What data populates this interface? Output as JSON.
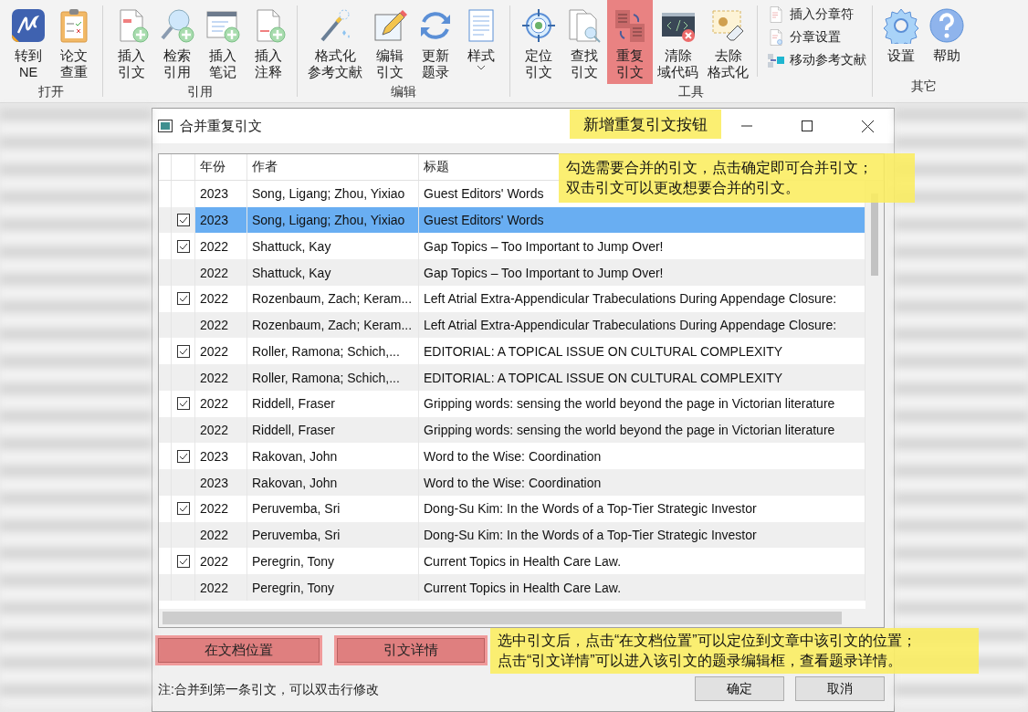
{
  "ribbon": {
    "groups": [
      {
        "label": "打开",
        "buttons": [
          {
            "lines": [
              "转到",
              "NE"
            ],
            "highlighted": false
          },
          {
            "lines": [
              "论文",
              "查重"
            ],
            "highlighted": false
          }
        ]
      },
      {
        "label": "引用",
        "buttons": [
          {
            "lines": [
              "插入",
              "引文"
            ],
            "highlighted": false
          },
          {
            "lines": [
              "检索",
              "引用"
            ],
            "highlighted": false
          },
          {
            "lines": [
              "插入",
              "笔记"
            ],
            "highlighted": false
          },
          {
            "lines": [
              "插入",
              "注释"
            ],
            "highlighted": false
          }
        ]
      },
      {
        "label": "编辑",
        "buttons": [
          {
            "lines": [
              "格式化",
              "参考文献"
            ],
            "highlighted": false
          },
          {
            "lines": [
              "编辑",
              "引文"
            ],
            "highlighted": false
          },
          {
            "lines": [
              "更新",
              "题录"
            ],
            "highlighted": false
          },
          {
            "lines": [
              "样式"
            ],
            "highlighted": false,
            "dropdown": true
          }
        ]
      },
      {
        "label": "工具",
        "buttons": [
          {
            "lines": [
              "定位",
              "引文"
            ],
            "highlighted": false
          },
          {
            "lines": [
              "查找",
              "引文"
            ],
            "highlighted": false
          },
          {
            "lines": [
              "重复",
              "引文"
            ],
            "highlighted": true
          },
          {
            "lines": [
              "清除",
              "域代码"
            ],
            "highlighted": false
          },
          {
            "lines": [
              "去除",
              "格式化"
            ],
            "highlighted": false
          }
        ],
        "small_buttons": [
          {
            "label": "插入分章符"
          },
          {
            "label": "分章设置"
          },
          {
            "label": "移动参考文献"
          }
        ]
      },
      {
        "label": "其它",
        "buttons": [
          {
            "lines": [
              "设置"
            ],
            "highlighted": false
          },
          {
            "lines": [
              "帮助"
            ],
            "highlighted": false
          }
        ]
      }
    ]
  },
  "dialog": {
    "title": "合并重复引文",
    "columns": [
      "年份",
      "作者",
      "标题"
    ],
    "rows": [
      {
        "checked": false,
        "selected": false,
        "year": "2023",
        "author": "Song, Ligang; Zhou, Yixiao",
        "title": "Guest Editors' Words"
      },
      {
        "checked": true,
        "selected": true,
        "year": "2023",
        "author": "Song, Ligang; Zhou, Yixiao",
        "title": "Guest Editors' Words"
      },
      {
        "checked": true,
        "selected": false,
        "year": "2022",
        "author": "Shattuck, Kay",
        "title": "Gap Topics – Too Important to Jump Over!"
      },
      {
        "checked": false,
        "selected": false,
        "year": "2022",
        "author": "Shattuck, Kay",
        "title": "Gap Topics – Too Important to Jump Over!"
      },
      {
        "checked": true,
        "selected": false,
        "year": "2022",
        "author": "Rozenbaum, Zach; Keram...",
        "title": "Left Atrial Extra-Appendicular Trabeculations During Appendage Closure:"
      },
      {
        "checked": false,
        "selected": false,
        "year": "2022",
        "author": "Rozenbaum, Zach; Keram...",
        "title": "Left Atrial Extra-Appendicular Trabeculations During Appendage Closure:"
      },
      {
        "checked": true,
        "selected": false,
        "year": "2022",
        "author": "Roller, Ramona; Schich,...",
        "title": "EDITORIAL: A TOPICAL ISSUE ON CULTURAL COMPLEXITY"
      },
      {
        "checked": false,
        "selected": false,
        "year": "2022",
        "author": "Roller, Ramona; Schich,...",
        "title": "EDITORIAL: A TOPICAL ISSUE ON CULTURAL COMPLEXITY"
      },
      {
        "checked": true,
        "selected": false,
        "year": "2022",
        "author": "Riddell, Fraser",
        "title": "Gripping words: sensing the world beyond the page in Victorian literature"
      },
      {
        "checked": false,
        "selected": false,
        "year": "2022",
        "author": "Riddell, Fraser",
        "title": "Gripping words: sensing the world beyond the page in Victorian literature"
      },
      {
        "checked": true,
        "selected": false,
        "year": "2023",
        "author": "Rakovan, John",
        "title": "Word to the Wise: Coordination"
      },
      {
        "checked": false,
        "selected": false,
        "year": "2023",
        "author": "Rakovan, John",
        "title": "Word to the Wise: Coordination"
      },
      {
        "checked": true,
        "selected": false,
        "year": "2022",
        "author": "Peruvemba, Sri",
        "title": "Dong-Su Kim: In the Words of a Top-Tier Strategic Investor"
      },
      {
        "checked": false,
        "selected": false,
        "year": "2022",
        "author": "Peruvemba, Sri",
        "title": "Dong-Su Kim: In the Words of a Top-Tier Strategic Investor"
      },
      {
        "checked": true,
        "selected": false,
        "year": "2022",
        "author": "Peregrin, Tony",
        "title": "Current Topics in Health Care Law."
      },
      {
        "checked": false,
        "selected": false,
        "year": "2022",
        "author": "Peregrin, Tony",
        "title": "Current Topics in Health Care Law."
      }
    ],
    "action_buttons": [
      {
        "label": "在文档位置",
        "highlighted": true
      },
      {
        "label": "引文详情",
        "highlighted": true
      }
    ],
    "note": "注:合并到第一条引文，可以双击行修改",
    "buttons": [
      "确定",
      "取消"
    ]
  },
  "callouts": [
    {
      "lines": [
        "新增重复引文按钮"
      ]
    },
    {
      "lines": [
        "勾选需要合并的引文，点击确定即可合并引文；",
        "双击引文可以更改想要合并的引文。"
      ]
    },
    {
      "lines": [
        "选中引文后，点击“在文档位置”可以定位到文章中该引文的位置；",
        "点击“引文详情”可以进入该引文的题录编辑框，查看题录详情。"
      ]
    }
  ]
}
